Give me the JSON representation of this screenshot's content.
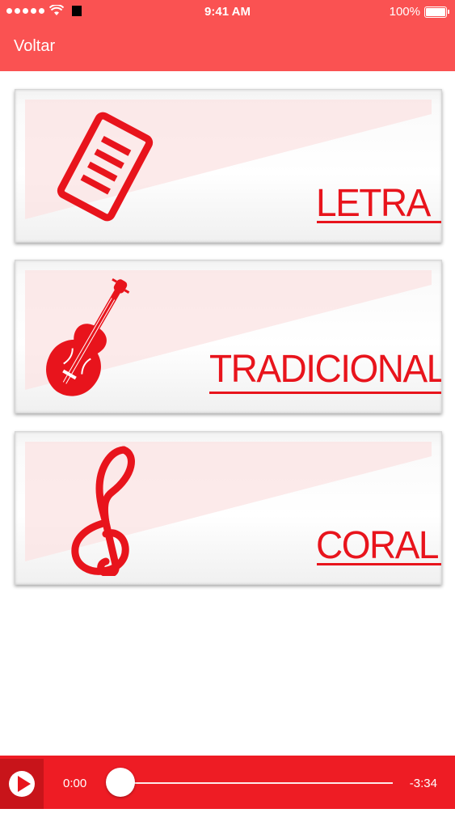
{
  "status_bar": {
    "time": "9:41 AM",
    "battery_text": "100%",
    "icons": [
      "signal-dots-icon",
      "wifi-icon",
      "square-icon",
      "battery-icon"
    ]
  },
  "nav": {
    "back_label": "Voltar"
  },
  "menu": {
    "items": [
      {
        "label": "LETRA",
        "icon": "lyrics-document-icon"
      },
      {
        "label": "TRADICIONAL",
        "icon": "violin-icon"
      },
      {
        "label": "CORAL",
        "icon": "treble-clef-icon"
      }
    ]
  },
  "player": {
    "elapsed": "0:00",
    "remaining": "-3:34",
    "progress": 0,
    "play_icon": "play-icon"
  },
  "colors": {
    "header": "#fa5252",
    "accent": "#e8141c",
    "player": "#ee1c24"
  }
}
